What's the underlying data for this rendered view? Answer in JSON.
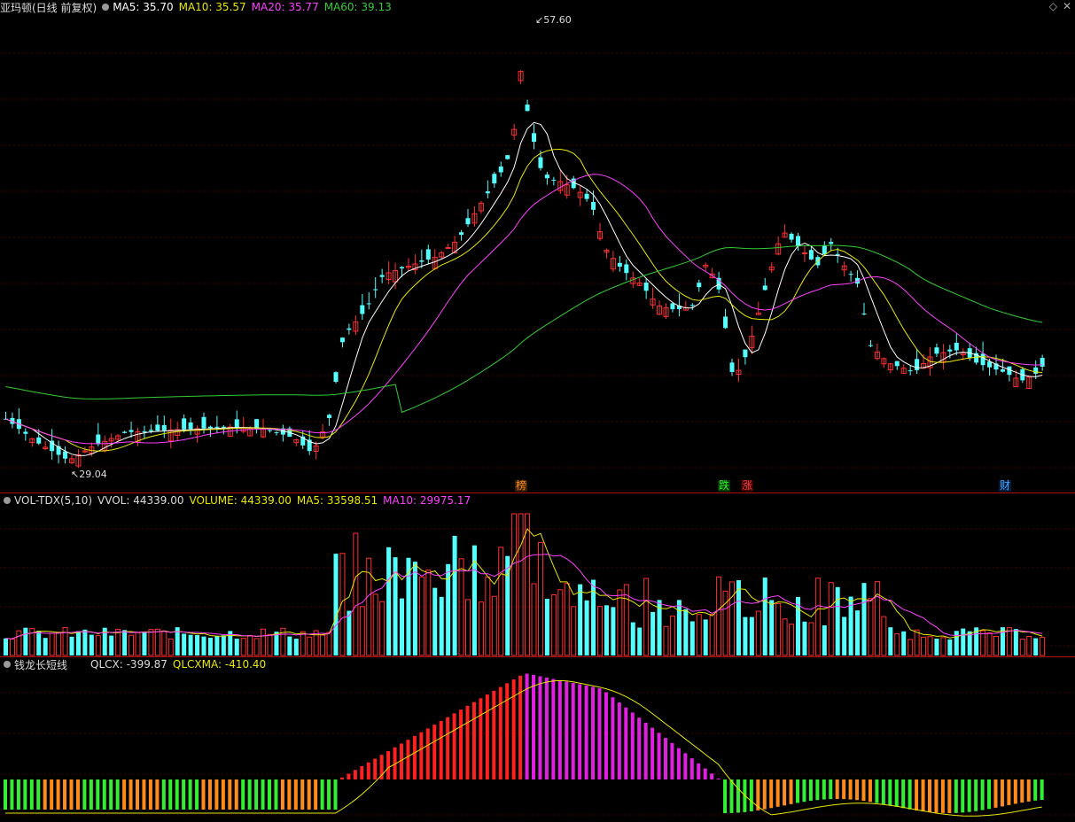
{
  "main": {
    "stock_label": "亚玛顿(日线 前复权)",
    "ma5": "MA5: 35.70",
    "ma10": "MA10: 35.57",
    "ma20": "MA20: 35.77",
    "ma60": "MA60: 39.13",
    "high_label": "57.60",
    "low_label": "29.04",
    "events": [
      {
        "text": "榜",
        "color": "#ff8c1a"
      },
      {
        "text": "跌",
        "color": "#33ee33"
      },
      {
        "text": "涨",
        "color": "#ff4040"
      },
      {
        "text": "财",
        "color": "#4aa8ff"
      }
    ],
    "colors": {
      "ma5": "#ffffff",
      "ma10": "#e8e800",
      "ma20": "#ff40ff",
      "ma60": "#33cc33",
      "up": "#ff3030",
      "down": "#54ffff"
    }
  },
  "volume": {
    "name": "VOL-TDX(5,10)",
    "vvol": "VVOL: 44339.00",
    "volume": "VOLUME: 44339.00",
    "ma5": "MA5: 33598.51",
    "ma10": "MA10: 29975.17"
  },
  "indicator": {
    "name": "钱龙长短线",
    "qlcx": "QLCX: -399.87",
    "qlcxma": "QLCXMA: -410.40"
  },
  "window_controls": {
    "restore_icon": "diamond-icon",
    "close_icon": "close-icon"
  }
}
